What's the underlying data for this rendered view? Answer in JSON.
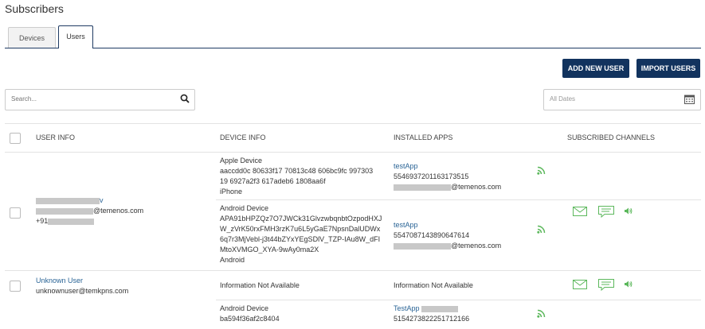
{
  "page": {
    "title": "Subscribers"
  },
  "tabs": [
    {
      "label": "Devices"
    },
    {
      "label": "Users"
    }
  ],
  "toolbar": {
    "add_user": "ADD NEW USER",
    "import_users": "IMPORT USERS"
  },
  "search": {
    "placeholder": "Search..."
  },
  "date_filter": {
    "label": "All Dates"
  },
  "table": {
    "headers": [
      "USER INFO",
      "DEVICE INFO",
      "INSTALLED APPS",
      "SUBSCRIBED CHANNELS"
    ],
    "rows": [
      {
        "user_name_suffix": "v",
        "user_email_suffix": "@temenos.com",
        "user_phone_prefix": "+91",
        "devices": [
          {
            "type": "Apple Device",
            "id_lines": [
              "aaccdd0c 80633f17 70813c48 606bc9fc 997303",
              "19 6927a2f3 617adeb6 1808aa6f"
            ],
            "os": "iPhone",
            "app": "testApp",
            "app_id": "5546937201163173515",
            "app_email_suffix": "@temenos.com"
          },
          {
            "type": "Android Device",
            "id_lines": [
              "APA91bHPZQz7O7JWCk31GlvzwbqnbtOzpodHXJ",
              "W_zVrK50rxFMH3rzK7u6L5yGaE7NpsnDalUDWx",
              "6q7r3MjVebl-j3t44bZYxYEgSDlV_TZP-IAu8W_dFI",
              "MtoXVMGO_XYA-9wAy0ma2X"
            ],
            "os": "Android",
            "app": "testApp",
            "app_id": "5547087143890647614",
            "app_email_suffix": "@temenos.com"
          }
        ]
      },
      {
        "user_name": "Unknown User",
        "user_email": "unknownuser@temkpns.com",
        "device_info": "Information Not Available",
        "apps_info": "Information Not Available"
      },
      {
        "device_type": "Android Device",
        "device_id": "ba594f36af2c8404",
        "app": "TestApp",
        "app_id": "5154273822251712166"
      }
    ]
  },
  "colors": {
    "primary": "#12335e",
    "link": "#2a6496",
    "channel_green": "#5cb85c"
  }
}
